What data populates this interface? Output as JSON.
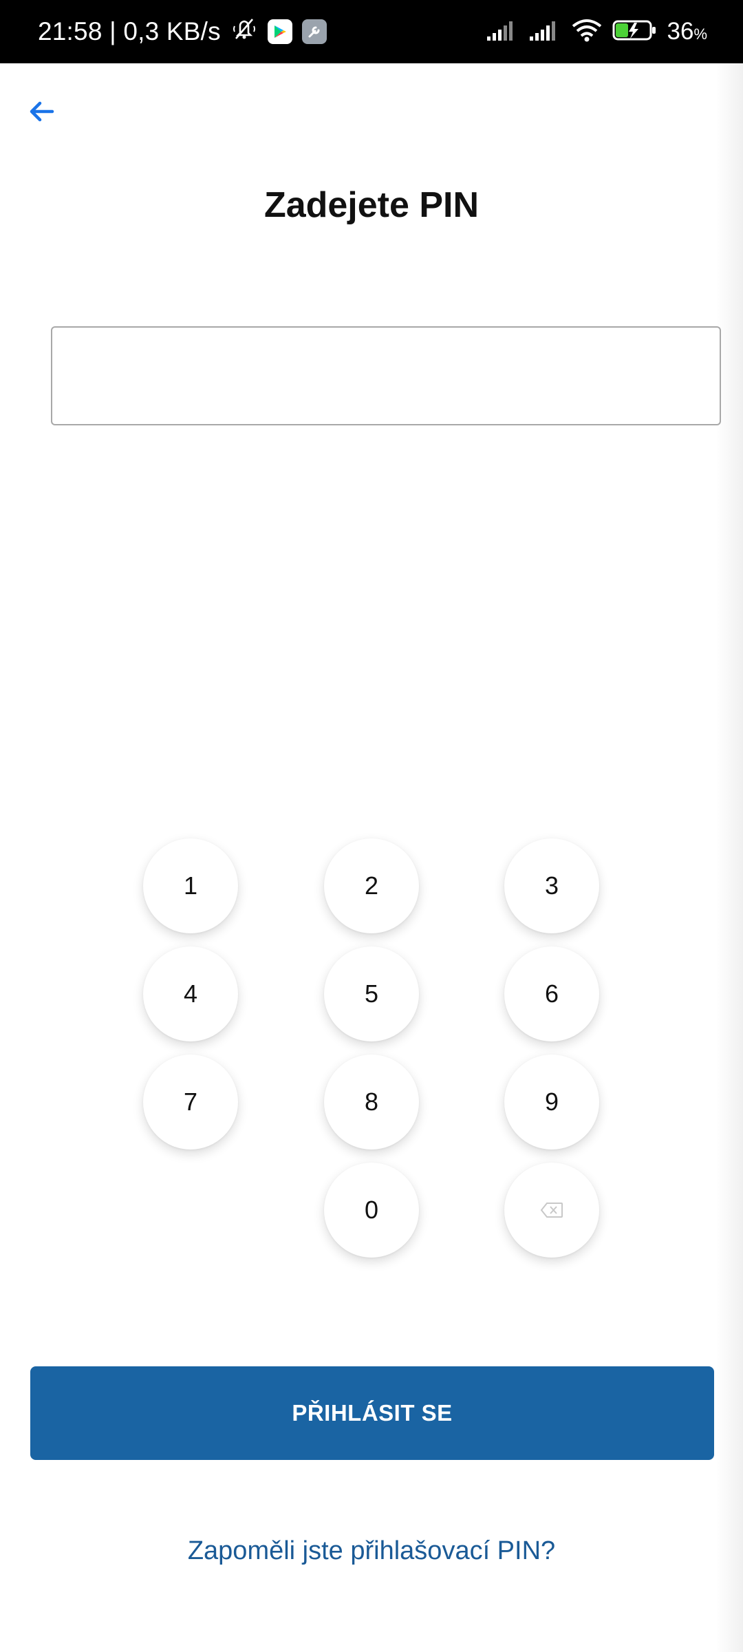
{
  "status_bar": {
    "time_speed": "21:58 | 0,3 KB/s",
    "battery_value": "36",
    "battery_unit": "%",
    "icons": [
      "mute-icon",
      "play-store-icon",
      "wrench-icon",
      "signal-icon",
      "signal-icon",
      "wifi-icon",
      "battery-charging-icon"
    ]
  },
  "header": {
    "back_icon": "arrow-left-icon",
    "title": "Zadejete PIN"
  },
  "pin_input": {
    "value": "",
    "placeholder": ""
  },
  "keypad": {
    "keys": [
      "1",
      "2",
      "3",
      "4",
      "5",
      "6",
      "7",
      "8",
      "9",
      "0"
    ],
    "backspace_icon": "backspace-icon"
  },
  "actions": {
    "login_label": "PŘIHLÁSIT SE",
    "forgot_label": "Zapoměli jste přihlašovací PIN?"
  },
  "colors": {
    "primary": "#1a64a3",
    "link": "#1a5a96",
    "back_arrow": "#1a73e8"
  }
}
